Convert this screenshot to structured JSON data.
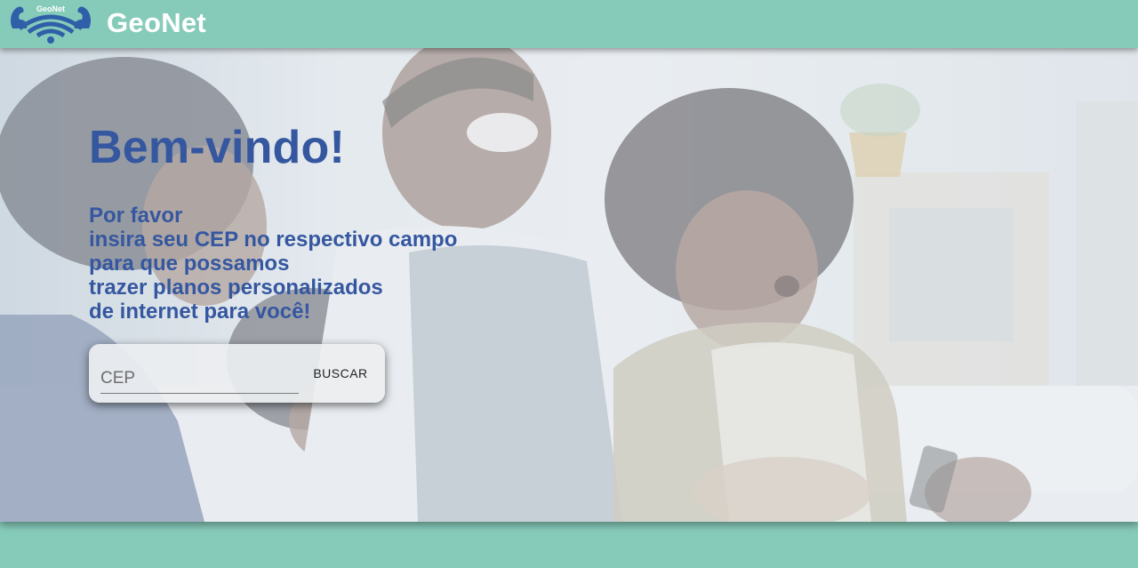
{
  "header": {
    "brand": "GeoNet",
    "logo_text": "GeoNet",
    "logo_icon": "wifi-muscle-logo-icon",
    "background_color": "#86cbb9"
  },
  "hero": {
    "background_image": "family-watching-tv-photo",
    "title": "Bem-vindo!",
    "message_lines": [
      "Por favor",
      "insira seu CEP no respectivo campo",
      "para que possamos",
      "trazer planos personalizados",
      "de internet para você!"
    ],
    "text_color": "#3557a0"
  },
  "search": {
    "cep_placeholder": "CEP",
    "cep_value": "",
    "button_label": "BUSCAR"
  }
}
